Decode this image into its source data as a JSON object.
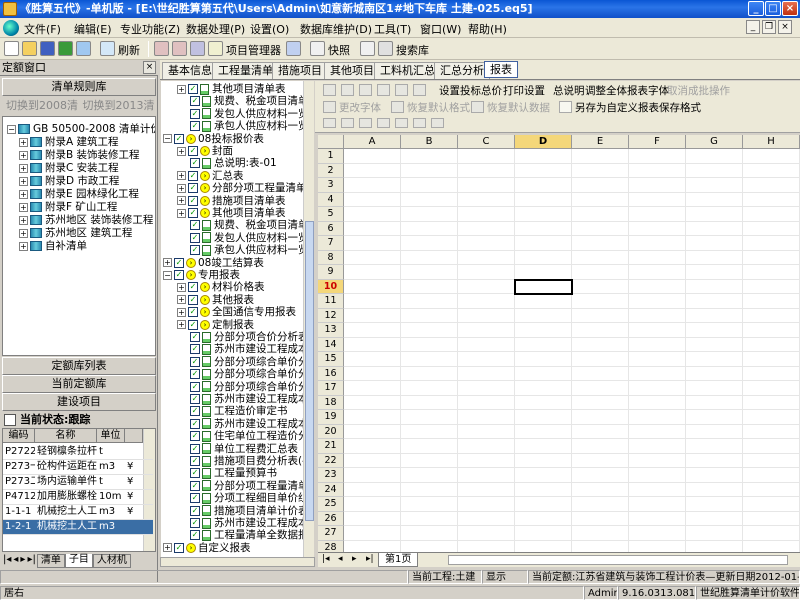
{
  "window": {
    "title": "《胜算五代》-单机版 - [E:\\世纪胜算第五代\\Users\\Admin\\如意新城南区1#地下车库 土建-025.eq5]"
  },
  "menu": [
    "文件(F)",
    "编辑(E)",
    "专业功能(Z)",
    "数据处理(P)",
    "设置(O)",
    "数据库维护(D)",
    "工具(T)",
    "窗口(W)",
    "帮助(H)"
  ],
  "toolbar": {
    "refresh": "刷新",
    "project_manager": "项目管理器",
    "snapshot": "快照",
    "search_lib": "搜索库"
  },
  "left": {
    "header": "定额窗口",
    "btn_list": "清单规则库",
    "switch_2008": "切换到2008清单",
    "switch_2013": "切换到2013清单",
    "tree": [
      {
        "label": "GB 50500-2008 清单计价规范",
        "level": 0,
        "prefix": "⊟"
      },
      {
        "label": "附录A 建筑工程",
        "level": 1
      },
      {
        "label": "附录B 装饰装修工程",
        "level": 1
      },
      {
        "label": "附录C 安装工程",
        "level": 1
      },
      {
        "label": "附录D 市政工程",
        "level": 1
      },
      {
        "label": "附录E 园林绿化工程",
        "level": 1
      },
      {
        "label": "附录F 矿山工程",
        "level": 1
      },
      {
        "label": "苏州地区 装饰装修工程",
        "level": 1
      },
      {
        "label": "苏州地区 建筑工程",
        "level": 1
      },
      {
        "label": "自补清单",
        "level": 1
      }
    ],
    "btn_quota_list": "定额库列表",
    "btn_current_quota": "当前定额库",
    "btn_build_project": "建设项目",
    "status": "当前状态:跟踪",
    "table": {
      "headers": [
        "编码",
        "名称",
        "单位",
        ""
      ],
      "rows": [
        [
          "P2722",
          "轻钢檩条拉杆:",
          "t",
          ""
        ],
        [
          "P273一",
          "砼构件运距在:",
          "m3",
          "¥"
        ],
        [
          "P273二",
          "场内运输单件:",
          "t",
          "¥"
        ],
        [
          "P4712",
          "加用膨胀螺栓)",
          "10m",
          "¥"
        ],
        [
          "1-1-1",
          "机械挖土人工(",
          "m3",
          "¥"
        ],
        [
          "1-2-1",
          "机械挖土人工(",
          "m3",
          ""
        ]
      ]
    },
    "tabs": [
      "清单",
      "子目",
      "人材机"
    ]
  },
  "tabs": [
    "基本信息",
    "工程量清单",
    "措施项目",
    "其他项目",
    "工料机汇总",
    "汇总分析",
    "报表"
  ],
  "report_tree": [
    {
      "indent": 1,
      "label": "其他项目清单表",
      "icon": "doc",
      "exp": "⊞"
    },
    {
      "indent": 1,
      "label": "规费、税金项目清单",
      "icon": "doc",
      "exp": ""
    },
    {
      "indent": 1,
      "label": "发包人供应材料一览",
      "icon": "doc",
      "exp": ""
    },
    {
      "indent": 1,
      "label": "承包人供应材料一览",
      "icon": "doc",
      "exp": ""
    },
    {
      "indent": 0,
      "label": "08投标报价表",
      "icon": "folder",
      "exp": "⊟"
    },
    {
      "indent": 1,
      "label": "封面",
      "icon": "folder",
      "exp": "⊞"
    },
    {
      "indent": 1,
      "label": "总说明:表-01",
      "icon": "doc",
      "exp": ""
    },
    {
      "indent": 1,
      "label": "汇总表",
      "icon": "folder",
      "exp": "⊞"
    },
    {
      "indent": 1,
      "label": "分部分项工程量清单",
      "icon": "folder",
      "exp": "⊞"
    },
    {
      "indent": 1,
      "label": "措施项目清单表",
      "icon": "folder",
      "exp": "⊞"
    },
    {
      "indent": 1,
      "label": "其他项目清单表",
      "icon": "folder",
      "exp": "⊞"
    },
    {
      "indent": 1,
      "label": "规费、税金项目清单",
      "icon": "doc",
      "exp": ""
    },
    {
      "indent": 1,
      "label": "发包人供应材料一览",
      "icon": "doc",
      "exp": ""
    },
    {
      "indent": 1,
      "label": "承包人供应材料一览",
      "icon": "doc",
      "exp": ""
    },
    {
      "indent": 0,
      "label": "08竣工结算表",
      "icon": "folder",
      "exp": "⊞"
    },
    {
      "indent": 0,
      "label": "专用报表",
      "icon": "folder",
      "exp": "⊟"
    },
    {
      "indent": 1,
      "label": "材料价格表",
      "icon": "folder",
      "exp": "⊞"
    },
    {
      "indent": 1,
      "label": "其他报表",
      "icon": "folder",
      "exp": "⊞"
    },
    {
      "indent": 1,
      "label": "全国通信专用报表",
      "icon": "folder",
      "exp": "⊞"
    },
    {
      "indent": 1,
      "label": "定制报表",
      "icon": "folder",
      "exp": "⊞"
    },
    {
      "indent": 1,
      "label": "分部分项合价分析表",
      "icon": "doc",
      "exp": ""
    },
    {
      "indent": 1,
      "label": "苏州市建设工程成本",
      "icon": "doc",
      "exp": ""
    },
    {
      "indent": 1,
      "label": "分部分项综合单价分",
      "icon": "doc",
      "exp": ""
    },
    {
      "indent": 1,
      "label": "分部分项综合单价分",
      "icon": "doc",
      "exp": ""
    },
    {
      "indent": 1,
      "label": "分部分项综合单价分",
      "icon": "doc",
      "exp": ""
    },
    {
      "indent": 1,
      "label": "苏州市建设工程成本",
      "icon": "doc",
      "exp": ""
    },
    {
      "indent": 1,
      "label": "工程造价审定书",
      "icon": "doc",
      "exp": ""
    },
    {
      "indent": 1,
      "label": "苏州市建设工程成本",
      "icon": "doc",
      "exp": ""
    },
    {
      "indent": 1,
      "label": "住宅单位工程造价分",
      "icon": "doc",
      "exp": ""
    },
    {
      "indent": 1,
      "label": "单位工程费汇总表",
      "icon": "doc",
      "exp": ""
    },
    {
      "indent": 1,
      "label": "措施项目费分析表(4",
      "icon": "doc",
      "exp": ""
    },
    {
      "indent": 1,
      "label": "工程量预算书",
      "icon": "doc",
      "exp": ""
    },
    {
      "indent": 1,
      "label": "分部分项工程量清单",
      "icon": "doc",
      "exp": ""
    },
    {
      "indent": 1,
      "label": "分项工程细目单价组",
      "icon": "doc",
      "exp": ""
    },
    {
      "indent": 1,
      "label": "措施项目清单计价表",
      "icon": "doc",
      "exp": ""
    },
    {
      "indent": 1,
      "label": "苏州市建设工程成本",
      "icon": "doc",
      "exp": ""
    },
    {
      "indent": 1,
      "label": "工程量清单全数据报",
      "icon": "doc",
      "exp": ""
    },
    {
      "indent": 0,
      "label": "自定义报表",
      "icon": "folder",
      "exp": "⊞"
    }
  ],
  "report_toolbar": {
    "set_total_price": "设置投标总价",
    "print_settings": "打印设置",
    "general_notes": "总说明",
    "adjust_font": "调整全体报表字体",
    "cancel_batch": "取消成批操作",
    "change_font": "更改字体",
    "restore_default_format": "恢复默认格式",
    "restore_default_data": "恢复默认数据",
    "save_as_custom": "另存为自定义报表",
    "save_format": "保存格式"
  },
  "grid": {
    "columns": [
      "A",
      "B",
      "C",
      "D",
      "E",
      "F",
      "G",
      "H"
    ],
    "rows": [
      "1",
      "2",
      "3",
      "4",
      "5",
      "6",
      "7",
      "8",
      "9",
      "10",
      "11",
      "12",
      "13",
      "14",
      "15",
      "16",
      "17",
      "18",
      "19",
      "20",
      "21",
      "22",
      "23",
      "24",
      "25",
      "26",
      "27",
      "28"
    ],
    "selected_col": "D",
    "selected_row": "10",
    "sheet_tab": "第1页"
  },
  "status": {
    "current_project": "当前工程:土建",
    "show": "显示",
    "current_quota": "当前定额:江苏省建筑与装饰工程计价表—更新日期2012-01-01",
    "position": "居右",
    "user": "Admin",
    "version": "9.16.0313.0818",
    "product": "世纪胜算清单计价软件"
  }
}
